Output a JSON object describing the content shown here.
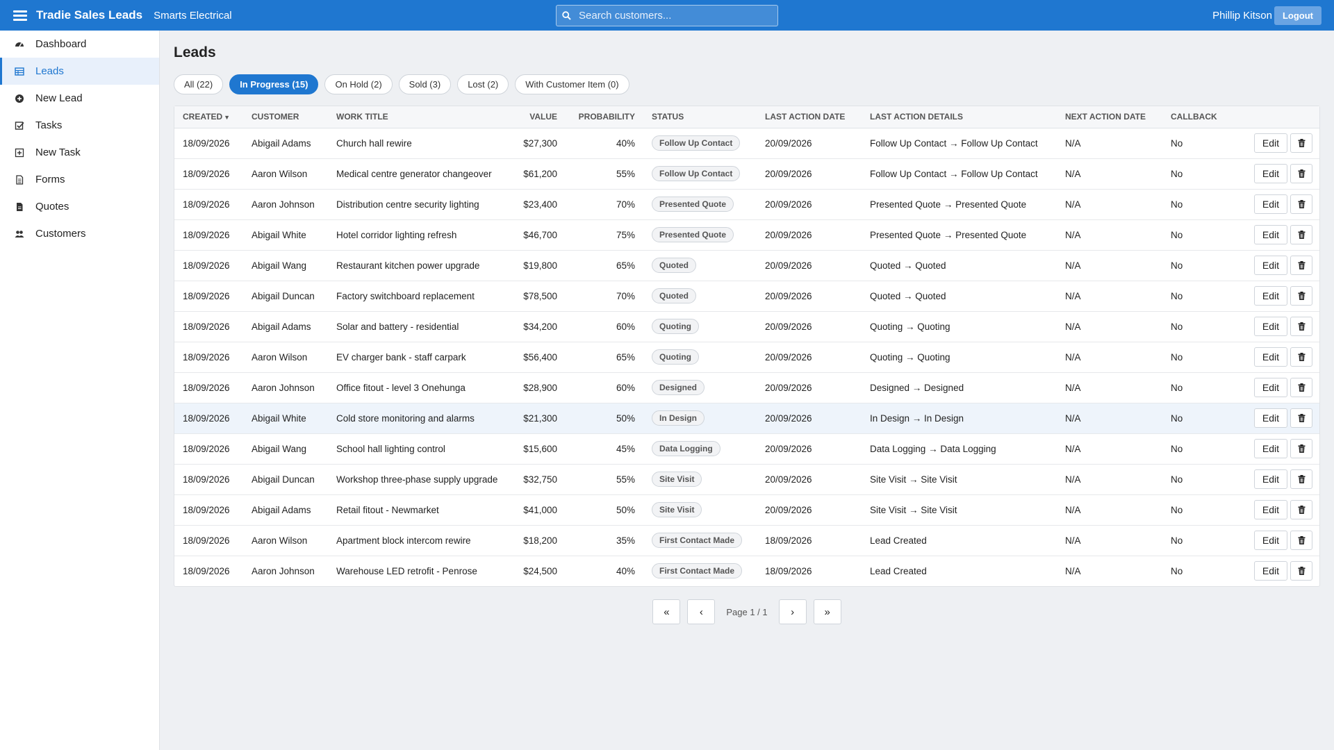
{
  "header": {
    "app_title": "Tradie Sales Leads",
    "company": "Smarts Electrical",
    "search_placeholder": "Search customers...",
    "user_name": "Phillip Kitson",
    "logout_label": "Logout"
  },
  "sidebar": {
    "items": [
      {
        "label": "Dashboard",
        "icon": "dashboard-icon"
      },
      {
        "label": "Leads",
        "icon": "table-icon"
      },
      {
        "label": "New Lead",
        "icon": "plus-circle-icon"
      },
      {
        "label": "Tasks",
        "icon": "checkbox-icon"
      },
      {
        "label": "New Task",
        "icon": "plus-square-icon"
      },
      {
        "label": "Forms",
        "icon": "document-icon"
      },
      {
        "label": "Quotes",
        "icon": "file-icon"
      },
      {
        "label": "Customers",
        "icon": "users-icon"
      }
    ],
    "active_index": 1
  },
  "main": {
    "title": "Leads",
    "tabs": [
      {
        "label": "All (22)"
      },
      {
        "label": "In Progress (15)"
      },
      {
        "label": "On Hold (2)"
      },
      {
        "label": "Sold (3)"
      },
      {
        "label": "Lost (2)"
      },
      {
        "label": "With Customer Item (0)"
      }
    ],
    "active_tab": 1
  },
  "table": {
    "columns": [
      "Created",
      "Customer",
      "Work Title",
      "Value",
      "Probability",
      "Status",
      "Last Action Date",
      "Last Action Details",
      "Next Action Date",
      "Callback"
    ],
    "sort_indicator": "▼",
    "edit_label": "Edit",
    "rows": [
      {
        "created": "18/09/2026",
        "customer": "Abigail Adams",
        "work_title": "Church hall rewire",
        "value": "$27,300",
        "probability": "40%",
        "status": "Follow Up Contact",
        "last_action_date": "20/09/2026",
        "last_action_details": "Follow Up Contact → Follow Up Contact",
        "next_action_date": "N/A",
        "callback": "No"
      },
      {
        "created": "18/09/2026",
        "customer": "Aaron Wilson",
        "work_title": "Medical centre generator changeover",
        "value": "$61,200",
        "probability": "55%",
        "status": "Follow Up Contact",
        "last_action_date": "20/09/2026",
        "last_action_details": "Follow Up Contact → Follow Up Contact",
        "next_action_date": "N/A",
        "callback": "No"
      },
      {
        "created": "18/09/2026",
        "customer": "Aaron Johnson",
        "work_title": "Distribution centre security lighting",
        "value": "$23,400",
        "probability": "70%",
        "status": "Presented Quote",
        "last_action_date": "20/09/2026",
        "last_action_details": "Presented Quote → Presented Quote",
        "next_action_date": "N/A",
        "callback": "No"
      },
      {
        "created": "18/09/2026",
        "customer": "Abigail White",
        "work_title": "Hotel corridor lighting refresh",
        "value": "$46,700",
        "probability": "75%",
        "status": "Presented Quote",
        "last_action_date": "20/09/2026",
        "last_action_details": "Presented Quote → Presented Quote",
        "next_action_date": "N/A",
        "callback": "No"
      },
      {
        "created": "18/09/2026",
        "customer": "Abigail Wang",
        "work_title": "Restaurant kitchen power upgrade",
        "value": "$19,800",
        "probability": "65%",
        "status": "Quoted",
        "last_action_date": "20/09/2026",
        "last_action_details": "Quoted → Quoted",
        "next_action_date": "N/A",
        "callback": "No"
      },
      {
        "created": "18/09/2026",
        "customer": "Abigail Duncan",
        "work_title": "Factory switchboard replacement",
        "value": "$78,500",
        "probability": "70%",
        "status": "Quoted",
        "last_action_date": "20/09/2026",
        "last_action_details": "Quoted → Quoted",
        "next_action_date": "N/A",
        "callback": "No"
      },
      {
        "created": "18/09/2026",
        "customer": "Abigail Adams",
        "work_title": "Solar and battery - residential",
        "value": "$34,200",
        "probability": "60%",
        "status": "Quoting",
        "last_action_date": "20/09/2026",
        "last_action_details": "Quoting → Quoting",
        "next_action_date": "N/A",
        "callback": "No"
      },
      {
        "created": "18/09/2026",
        "customer": "Aaron Wilson",
        "work_title": "EV charger bank - staff carpark",
        "value": "$56,400",
        "probability": "65%",
        "status": "Quoting",
        "last_action_date": "20/09/2026",
        "last_action_details": "Quoting → Quoting",
        "next_action_date": "N/A",
        "callback": "No"
      },
      {
        "created": "18/09/2026",
        "customer": "Aaron Johnson",
        "work_title": "Office fitout - level 3 Onehunga",
        "value": "$28,900",
        "probability": "60%",
        "status": "Designed",
        "last_action_date": "20/09/2026",
        "last_action_details": "Designed → Designed",
        "next_action_date": "N/A",
        "callback": "No"
      },
      {
        "created": "18/09/2026",
        "customer": "Abigail White",
        "work_title": "Cold store monitoring and alarms",
        "value": "$21,300",
        "probability": "50%",
        "status": "In Design",
        "last_action_date": "20/09/2026",
        "last_action_details": "In Design → In Design",
        "next_action_date": "N/A",
        "callback": "No"
      },
      {
        "created": "18/09/2026",
        "customer": "Abigail Wang",
        "work_title": "School hall lighting control",
        "value": "$15,600",
        "probability": "45%",
        "status": "Data Logging",
        "last_action_date": "20/09/2026",
        "last_action_details": "Data Logging → Data Logging",
        "next_action_date": "N/A",
        "callback": "No"
      },
      {
        "created": "18/09/2026",
        "customer": "Abigail Duncan",
        "work_title": "Workshop three-phase supply upgrade",
        "value": "$32,750",
        "probability": "55%",
        "status": "Site Visit",
        "last_action_date": "20/09/2026",
        "last_action_details": "Site Visit → Site Visit",
        "next_action_date": "N/A",
        "callback": "No"
      },
      {
        "created": "18/09/2026",
        "customer": "Abigail Adams",
        "work_title": "Retail fitout - Newmarket",
        "value": "$41,000",
        "probability": "50%",
        "status": "Site Visit",
        "last_action_date": "20/09/2026",
        "last_action_details": "Site Visit → Site Visit",
        "next_action_date": "N/A",
        "callback": "No"
      },
      {
        "created": "18/09/2026",
        "customer": "Aaron Wilson",
        "work_title": "Apartment block intercom rewire",
        "value": "$18,200",
        "probability": "35%",
        "status": "First Contact Made",
        "last_action_date": "18/09/2026",
        "last_action_details": "Lead Created",
        "next_action_date": "N/A",
        "callback": "No"
      },
      {
        "created": "18/09/2026",
        "customer": "Aaron Johnson",
        "work_title": "Warehouse LED retrofit - Penrose",
        "value": "$24,500",
        "probability": "40%",
        "status": "First Contact Made",
        "last_action_date": "18/09/2026",
        "last_action_details": "Lead Created",
        "next_action_date": "N/A",
        "callback": "No"
      }
    ],
    "highlighted_row": 9
  },
  "pagination": {
    "first": "«",
    "prev": "‹",
    "page_info": "Page 1 / 1",
    "next": "›",
    "last": "»"
  },
  "colors": {
    "primary": "#1f77d0",
    "background": "#eef0f3"
  }
}
